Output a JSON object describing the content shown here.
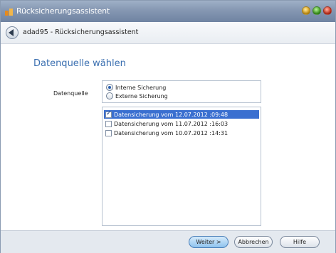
{
  "window": {
    "title": "Rücksicherungsassistent"
  },
  "nav": {
    "title": "adad95 - Rücksicherungsassistent"
  },
  "main": {
    "heading": "Datenquelle wählen",
    "source_label": "Datenquelle",
    "source_options": [
      {
        "label": "Interne Sicherung",
        "selected": true
      },
      {
        "label": "Externe Sicherung",
        "selected": false
      }
    ],
    "backups": [
      {
        "label": "Datensicherung vom 12.07.2012 :09:48",
        "checked": true,
        "selected": true
      },
      {
        "label": "Datensicherung vom 11.07.2012 :16:03",
        "checked": false,
        "selected": false
      },
      {
        "label": "Datensicherung vom 10.07.2012 :14:31",
        "checked": false,
        "selected": false
      }
    ]
  },
  "footer": {
    "next_label": "Weiter >",
    "cancel_label": "Abbrechen",
    "help_label": "Hilfe"
  },
  "colors": {
    "accent": "#3a6fd0",
    "heading": "#3a6fb0"
  }
}
